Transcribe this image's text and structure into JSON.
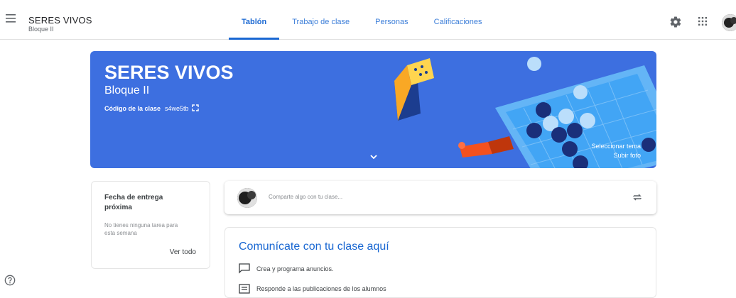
{
  "app": {
    "title": "SERES VIVOS",
    "subtitle": "Bloque II"
  },
  "tabs": [
    {
      "label": "Tablón",
      "active": true
    },
    {
      "label": "Trabajo de clase",
      "active": false
    },
    {
      "label": "Personas",
      "active": false
    },
    {
      "label": "Calificaciones",
      "active": false
    }
  ],
  "icons": {
    "menu": "menu-icon",
    "settings": "gear-icon",
    "apps": "apps-grid-icon",
    "help": "help-icon",
    "expand": "fullscreen-icon",
    "chevron": "chevron-down-icon",
    "repost": "repost-icon",
    "announce": "chat-bubble-icon",
    "respond": "message-list-icon"
  },
  "banner": {
    "title": "SERES VIVOS",
    "subtitle": "Bloque II",
    "code_label": "Código de la clase",
    "code_value": "s4we5tb",
    "select_theme": "Seleccionar tema",
    "upload_photo": "Subir foto",
    "color": "#3d6fe0"
  },
  "upcoming": {
    "title": "Fecha de entrega próxima",
    "empty_text": "No tienes ninguna tarea para esta semana",
    "view_all": "Ver todo"
  },
  "share": {
    "placeholder": "Comparte algo con tu clase..."
  },
  "communicate": {
    "title": "Comunícate con tu clase aquí",
    "items": [
      "Crea y programa anuncios.",
      "Responde a las publicaciones de los alumnos"
    ]
  },
  "colors": {
    "accent": "#1967d2",
    "banner": "#3d6fe0",
    "text": "#3c4043"
  }
}
